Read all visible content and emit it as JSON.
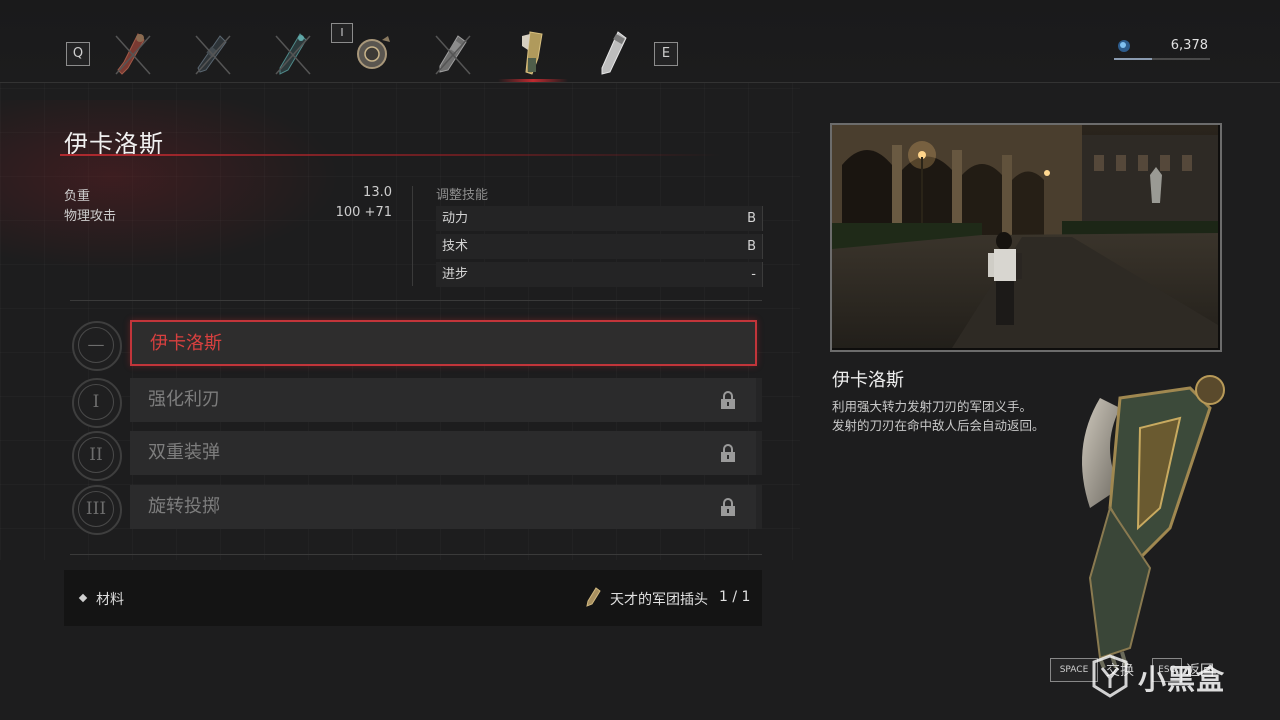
{
  "hotbar": {
    "left_key": "Q",
    "right_key": "E",
    "indicator_key": "I",
    "slots": [
      {
        "icon": "arm-weapon-icon",
        "disabled": true
      },
      {
        "icon": "arm-weapon-icon",
        "disabled": true
      },
      {
        "icon": "arm-weapon-icon",
        "disabled": true
      },
      {
        "icon": "arm-shield-icon",
        "disabled": false
      },
      {
        "icon": "arm-weapon-icon",
        "disabled": true
      },
      {
        "icon": "arm-blade-icon",
        "disabled": false,
        "active": true
      },
      {
        "icon": "arm-drill-icon",
        "disabled": false
      }
    ]
  },
  "currency": {
    "icon": "ergo-orb-icon",
    "value": "6,378",
    "bar_fraction": 0.4
  },
  "weapon": {
    "name": "伊卡洛斯",
    "stats": [
      {
        "label": "负重",
        "value": "13.0"
      },
      {
        "label": "物理攻击",
        "value": "100 +71"
      }
    ],
    "scaling_header": "调整技能",
    "scaling": [
      {
        "label": "动力",
        "grade": "B"
      },
      {
        "label": "技术",
        "grade": "B"
      },
      {
        "label": "进步",
        "grade": "-"
      }
    ]
  },
  "upgrades": [
    {
      "numeral": "—",
      "name": "伊卡洛斯",
      "selected": true,
      "locked": false
    },
    {
      "numeral": "I",
      "name": "强化利刃",
      "selected": false,
      "locked": true
    },
    {
      "numeral": "II",
      "name": "双重装弹",
      "selected": false,
      "locked": true
    },
    {
      "numeral": "III",
      "name": "旋转投掷",
      "selected": false,
      "locked": true
    }
  ],
  "materials": {
    "label": "材料",
    "item_name": "天才的军团插头",
    "item_count": "1 / 1"
  },
  "detail": {
    "title": "伊卡洛斯",
    "description_line1": "利用强大转力发射刀刃的军团义手。",
    "description_line2": "发射的刀刃在命中敌人后会自动返回。"
  },
  "prompts": {
    "space_key": "SPACE",
    "space_label": "交换",
    "esc_key": "ESC",
    "esc_label": "返回"
  },
  "watermark": {
    "text": "小黑盒"
  },
  "colors": {
    "accent_red": "#c2353a",
    "background": "#1d1d1e",
    "panel": "#2b2b2c"
  }
}
